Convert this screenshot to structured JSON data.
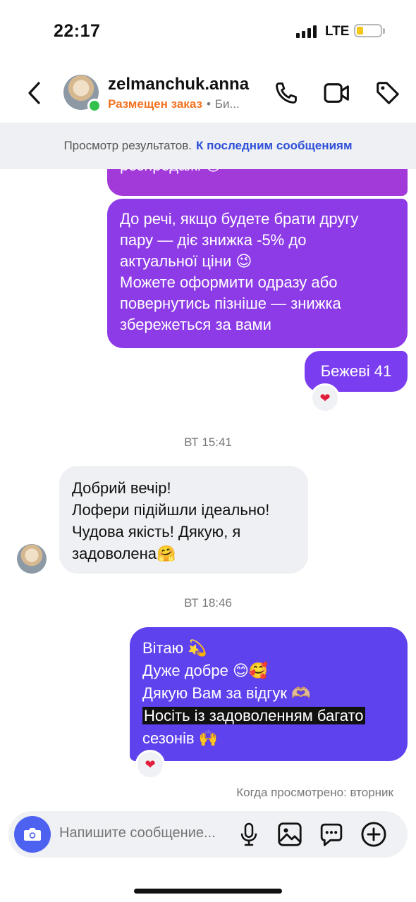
{
  "status_bar": {
    "time": "22:17",
    "network": "LTE",
    "battery_level": 0.2
  },
  "header": {
    "name": "zelmanchuk.anna",
    "status": "Размещен заказ",
    "separator": "•",
    "extra": "Би...",
    "icons": {
      "back": "chevron-left-icon",
      "call": "phone-icon",
      "video": "video-camera-icon",
      "tag": "tag-icon"
    },
    "online": true
  },
  "banner": {
    "text": "Просмотр результатов.",
    "link": "К последним сообщениям"
  },
  "messages": {
    "out_1": {
      "line1": "розпродажі 😍"
    },
    "out_2": {
      "line1": "До речі, якщо будете брати другу",
      "line2": "пару — діє знижка -5% до",
      "line3": "актуальної ціни 😉",
      "line4": "Можете оформити одразу або",
      "line5": "повернутись пізніше — знижка",
      "line6": "збережеться за вами"
    },
    "out_3": {
      "text": "Бежеві 41",
      "reaction": "❤"
    },
    "time_1": "ВТ 15:41",
    "in_1": {
      "line1": "Добрий вечір!",
      "line2": "Лофери підійшли ідеально!",
      "line3": "Чудова якість! Дякую, я",
      "line4": "задоволена🤗"
    },
    "time_2": "ВТ 18:46",
    "out_4": {
      "line1": "Вітаю 💫",
      "line2": "Дуже добре 😊🥰",
      "line3": "Дякую Вам за відгук 🫶🏼",
      "line4": "Носіть із задоволенням багато",
      "line5": "сезонів 🙌",
      "reaction": "❤"
    },
    "seen": "Когда просмотрено: вторник"
  },
  "composer": {
    "placeholder": "Напишите сообщение...",
    "icons": {
      "camera": "camera-icon",
      "mic": "microphone-icon",
      "gallery": "image-icon",
      "sticker": "chat-bubble-icon",
      "add": "plus-circle-icon"
    }
  },
  "colors": {
    "accent": "#4d62f0",
    "order_status": "#f37321",
    "online": "#33c14d",
    "link": "#2f4fd9"
  }
}
